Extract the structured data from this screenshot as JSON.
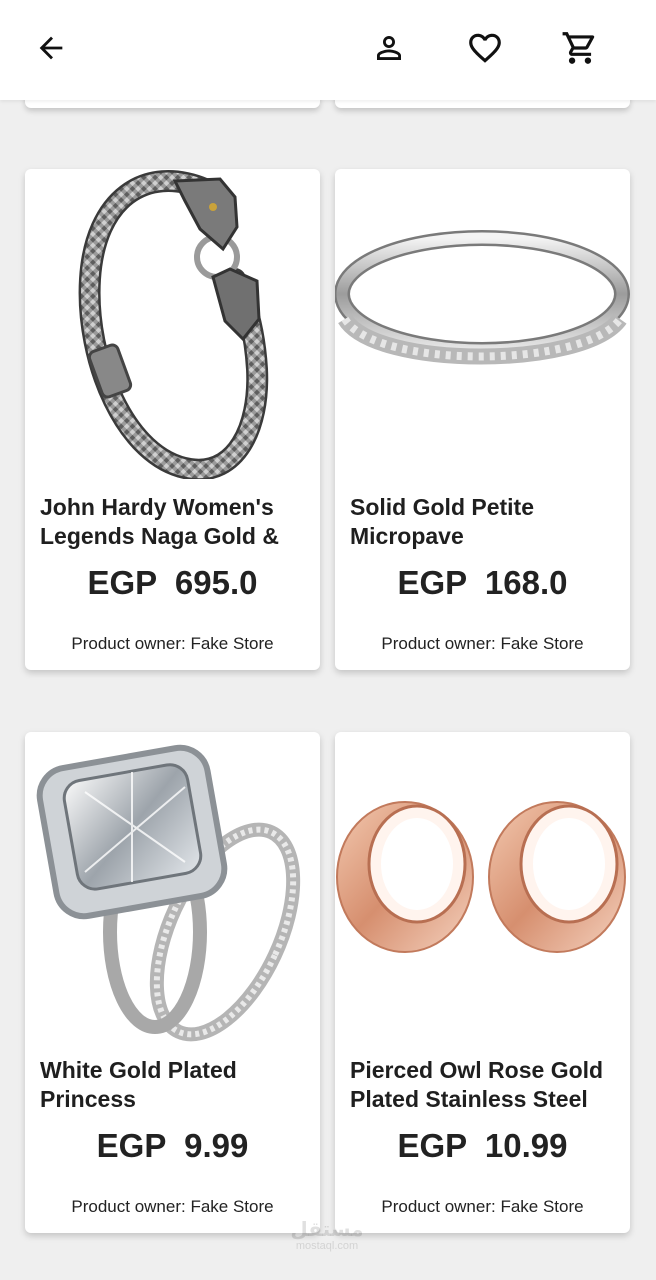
{
  "header": {
    "back_icon": "arrow-left-icon",
    "account_icon": "person-icon",
    "favorites_icon": "heart-outline-icon",
    "cart_icon": "cart-icon"
  },
  "products": [
    {
      "title": "John Hardy Women's Legends Naga Gold &",
      "price": "EGP  695.0",
      "owner": "Product owner: Fake Store"
    },
    {
      "title": "Solid Gold Petite Micropave",
      "price": "EGP  168.0",
      "owner": "Product owner: Fake Store"
    },
    {
      "title": "White Gold Plated Princess",
      "price": "EGP  9.99",
      "owner": "Product owner: Fake Store"
    },
    {
      "title": "Pierced Owl Rose Gold Plated Stainless Steel",
      "price": "EGP  10.99",
      "owner": "Product owner: Fake Store"
    }
  ],
  "watermark": {
    "text": "مستقل",
    "sub": "mostaql.com"
  },
  "colors": {
    "background": "#efefef",
    "card": "#ffffff",
    "text": "#1f1f1f"
  }
}
